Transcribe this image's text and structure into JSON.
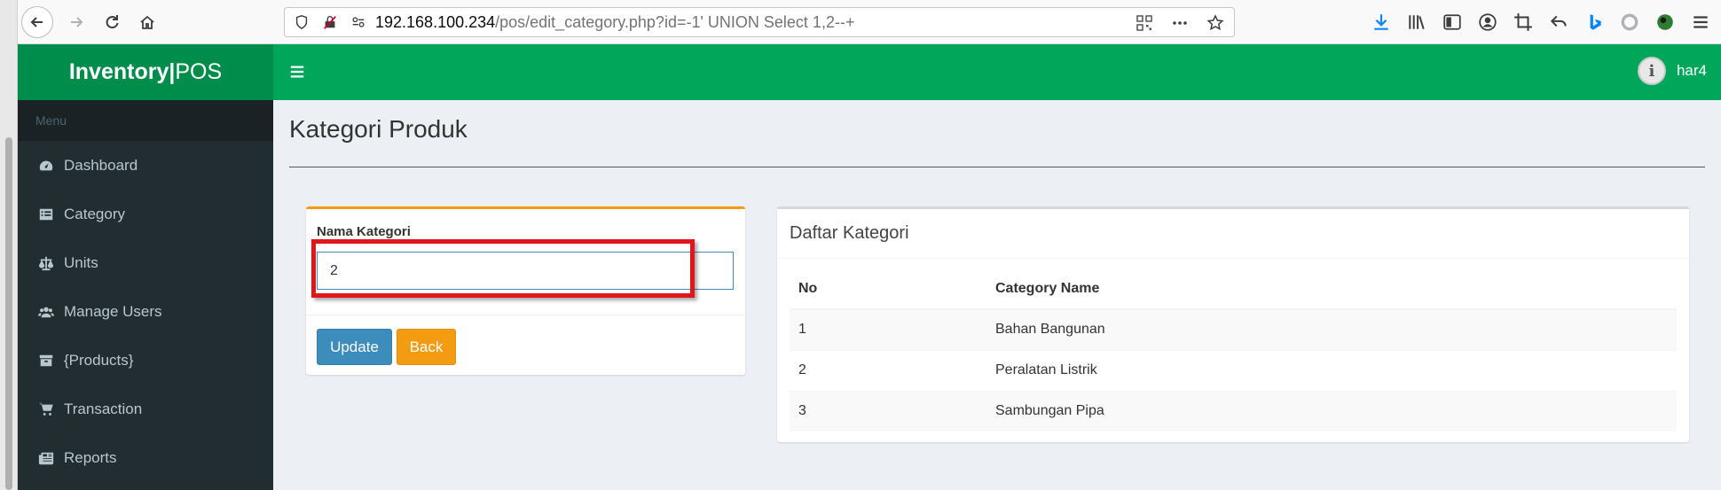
{
  "browser": {
    "url_host": "192.168.100.234",
    "url_path": "/pos/edit_category.php?id=-1' UNION Select 1,2--+"
  },
  "app": {
    "logo_bold": "Inventory",
    "logo_sep": "|",
    "logo_rest": "POS",
    "username": "har4",
    "avatar_letter": "i"
  },
  "sidebar": {
    "header": "Menu",
    "items": [
      {
        "label": "Dashboard",
        "icon": "dashboard-icon"
      },
      {
        "label": "Category",
        "icon": "list-alt-icon"
      },
      {
        "label": "Units",
        "icon": "balance-scale-icon"
      },
      {
        "label": "Manage Users",
        "icon": "users-icon"
      },
      {
        "label": "{Products}",
        "icon": "archive-icon"
      },
      {
        "label": "Transaction",
        "icon": "shopping-cart-icon"
      },
      {
        "label": "Reports",
        "icon": "newspaper-icon"
      }
    ]
  },
  "page": {
    "title": "Kategori Produk"
  },
  "form": {
    "label": "Nama Kategori",
    "value": "2",
    "update_label": "Update",
    "back_label": "Back"
  },
  "list": {
    "title": "Daftar Kategori",
    "columns": [
      "No",
      "Category Name"
    ],
    "rows": [
      {
        "no": "1",
        "name": "Bahan Bangunan"
      },
      {
        "no": "2",
        "name": "Peralatan Listrik"
      },
      {
        "no": "3",
        "name": "Sambungan Pipa"
      }
    ]
  },
  "colors": {
    "header_green": "#00a65a",
    "logo_green": "#008d4c",
    "sidebar_dark": "#222d32",
    "update_blue": "#3c8dbc",
    "back_orange": "#f39c12",
    "highlight_red": "#e0161b"
  }
}
